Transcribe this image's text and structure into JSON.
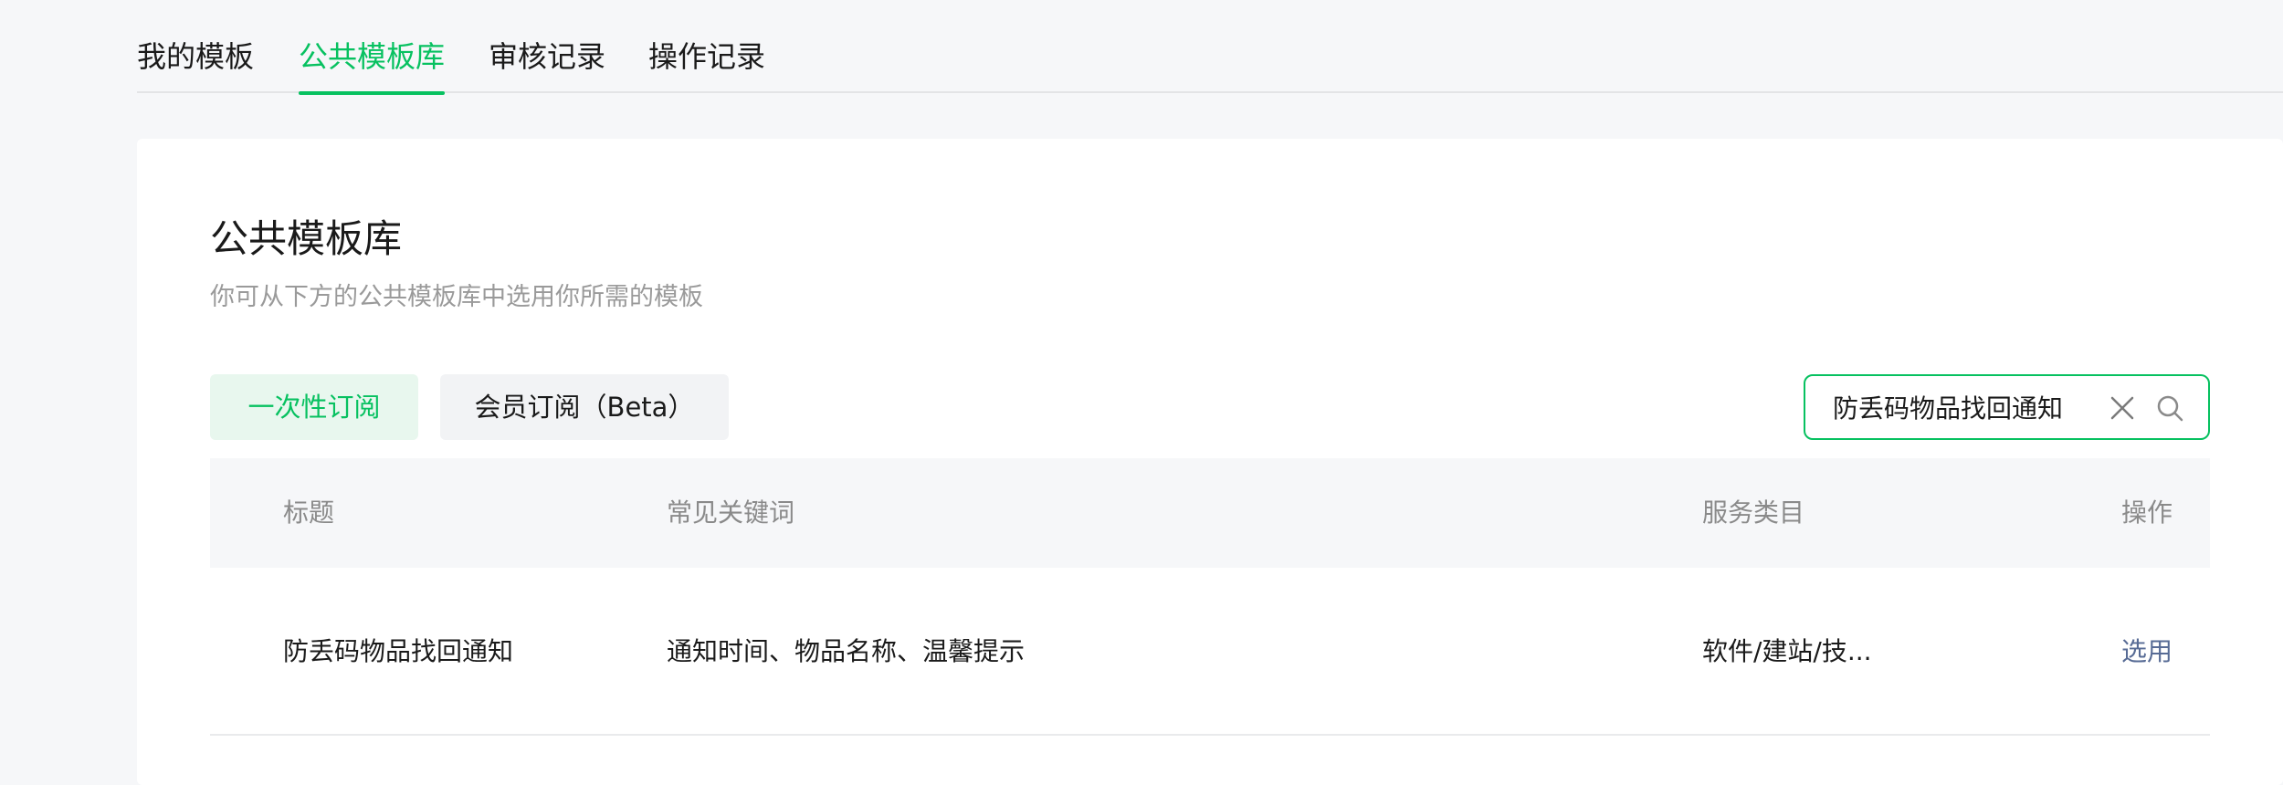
{
  "tabs": [
    {
      "label": "我的模板",
      "active": false
    },
    {
      "label": "公共模板库",
      "active": true
    },
    {
      "label": "审核记录",
      "active": false
    },
    {
      "label": "操作记录",
      "active": false
    }
  ],
  "page": {
    "title": "公共模板库",
    "subtitle": "你可从下方的公共模板库中选用你所需的模板"
  },
  "segments": [
    {
      "label": "一次性订阅",
      "active": true
    },
    {
      "label": "会员订阅（Beta）",
      "active": false
    }
  ],
  "search": {
    "value": "防丢码物品找回通知",
    "clear_icon": "close-icon",
    "search_icon": "search-icon"
  },
  "table": {
    "headers": {
      "title": "标题",
      "keywords": "常见关键词",
      "category": "服务类目",
      "action": "操作"
    },
    "rows": [
      {
        "title": "防丢码物品找回通知",
        "keywords": "通知时间、物品名称、温馨提示",
        "category": "软件/建站/技...",
        "action": "选用"
      }
    ]
  },
  "colors": {
    "accent": "#07c160",
    "accent_bg": "#e8f7ee",
    "link": "#576b95",
    "muted": "#9a9a9a",
    "page_bg": "#f6f7f9"
  }
}
